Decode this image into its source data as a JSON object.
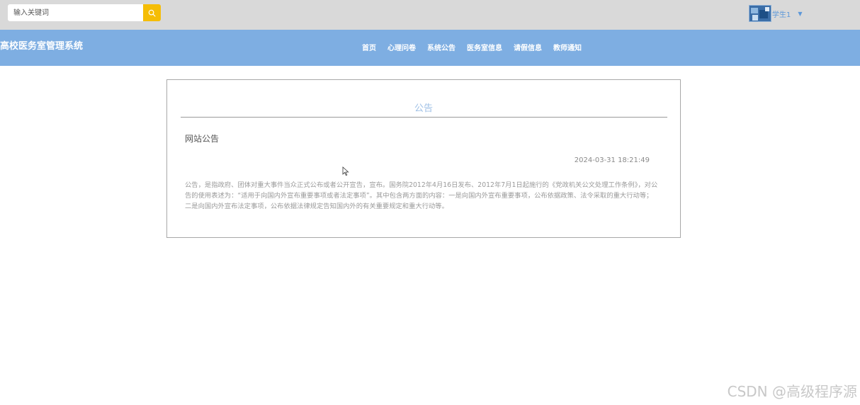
{
  "header": {
    "search": {
      "placeholder": "输入关键词",
      "value": "",
      "icon": "search-icon"
    },
    "user": {
      "name": "学生1",
      "avatar_icon": "avatar-image",
      "caret_icon": "chevron-down-icon"
    }
  },
  "navbar": {
    "brand": "高校医务室管理系统",
    "items": [
      {
        "label": "首页"
      },
      {
        "label": "心理问卷"
      },
      {
        "label": "系统公告"
      },
      {
        "label": "医务室信息"
      },
      {
        "label": "请假信息"
      },
      {
        "label": "教师通知"
      }
    ]
  },
  "notice": {
    "section_title": "公告",
    "title": "网站公告",
    "time": "2024-03-31 18:21:49",
    "content": "公告，是指政府、团体对重大事件当众正式公布或者公开宣告，宣布。国务院2012年4月16日发布、2012年7月1日起施行的《党政机关公文处理工作条例》，对公告的使用表述为：“适用于向国内外宣布重要事项或者法定事项”。其中包含两方面的内容：一是向国内外宣布重要事项，公布依据政策、法令采取的重大行动等；二是向国内外宣布法定事项，公布依据法律规定告知国内外的有关重要规定和重大行动等。"
  },
  "watermark": "CSDN @高级程序源",
  "colors": {
    "topbar": "#d9d9d9",
    "navbar": "#7eaee2",
    "search_button": "#f5bd06",
    "accent": "#9fc0e6"
  }
}
